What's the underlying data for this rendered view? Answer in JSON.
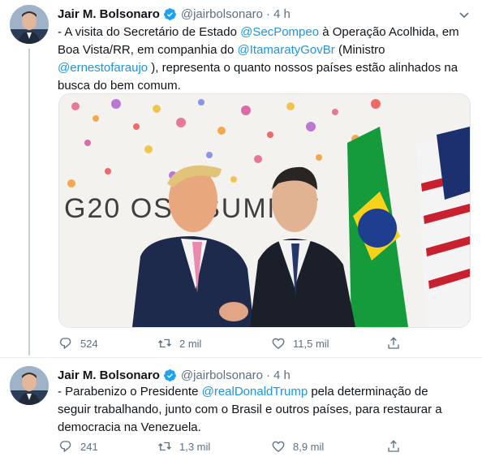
{
  "tweets": [
    {
      "author": {
        "name": "Jair M. Bolsonaro",
        "handle": "@jairbolsonaro"
      },
      "time": "4 h",
      "text_parts": [
        {
          "t": "- A visita do Secretário de Estado ",
          "link": false
        },
        {
          "t": "@SecPompeo",
          "link": true
        },
        {
          "t": " à Operação Acolhida, em Boa Vista/RR, em companhia do ",
          "link": false
        },
        {
          "t": "@ItamaratyGovBr",
          "link": true
        },
        {
          "t": " (Ministro ",
          "link": false
        },
        {
          "t": "@ernestofaraujo",
          "link": true
        },
        {
          "t": " ), representa o quanto nossos países estão alinhados na busca do bem comum.",
          "link": false
        }
      ],
      "photo_backdrop_text": "G20 OSA   SUMMIT",
      "stats": {
        "replies": "524",
        "retweets": "2 mil",
        "likes": "11,5 mil"
      }
    },
    {
      "author": {
        "name": "Jair M. Bolsonaro",
        "handle": "@jairbolsonaro"
      },
      "time": "4 h",
      "text_parts": [
        {
          "t": "- Parabenizo o Presidente ",
          "link": false
        },
        {
          "t": "@realDonaldTrump",
          "link": true
        },
        {
          "t": " pela determinação de seguir trabalhando, junto com o Brasil e outros países, para restaurar a democracia na Venezuela.",
          "link": false
        }
      ],
      "stats": {
        "replies": "241",
        "retweets": "1,3 mil",
        "likes": "8,9 mil"
      }
    }
  ],
  "colors": {
    "link": "#1b95e0",
    "muted": "#5b7083",
    "verified": "#1da1f2",
    "divider": "#e6ecf0"
  },
  "icons": [
    "verified-badge-icon",
    "caret-down-icon",
    "reply-icon",
    "retweet-icon",
    "like-icon",
    "share-icon"
  ]
}
